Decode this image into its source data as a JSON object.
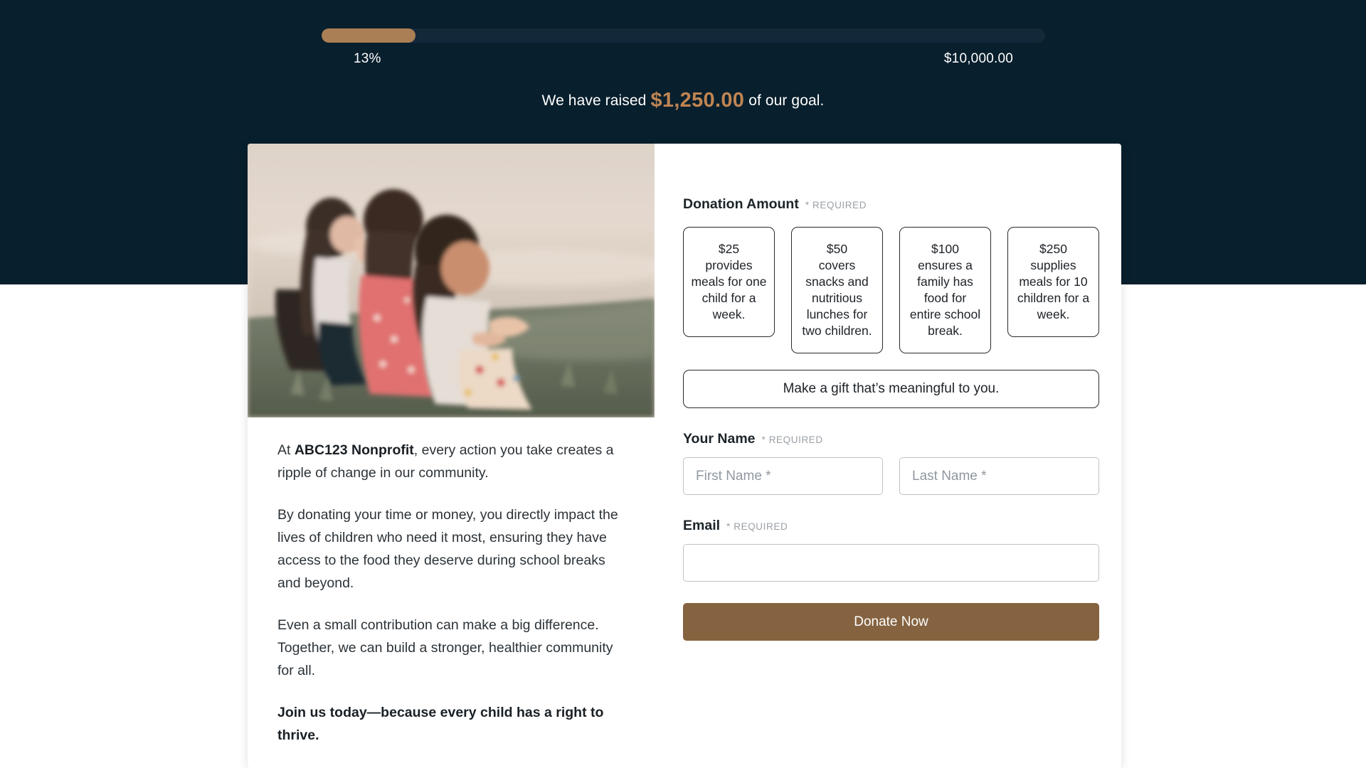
{
  "theme": {
    "band_background": "#081f2d",
    "progress_fill": "#ab7f55",
    "progress_track": "#13293a",
    "accent_amount": "#c08552",
    "button_background": "#856340",
    "card_background": "#ffffff"
  },
  "progress": {
    "percent_label": "13%",
    "percent_value": 13,
    "goal_label": "$10,000.00",
    "raised_prefix": "We have raised",
    "raised_amount": "$1,250.00",
    "raised_suffix": "of our goal."
  },
  "hero": {
    "alt": "Three children sitting together on grass looking out over a field"
  },
  "story": {
    "p1_lead": "At ",
    "p1_org": "ABC123 Nonprofit",
    "p1_rest": ", every action you take creates a ripple of change in our community.",
    "p2": "By donating your time or money, you directly impact the lives of children who need it most, ensuring they have access to the food they deserve during school breaks and beyond.",
    "p3": "Even a small contribution can make a big difference. Together, we can build a stronger, healthier community for all.",
    "p4": "Join us today—because every child has a right to thrive."
  },
  "form": {
    "donation_amount": {
      "label": "Donation Amount",
      "required_tag": "* REQUIRED",
      "options": [
        {
          "amount": "$25",
          "description": "provides meals for one child for a week."
        },
        {
          "amount": "$50",
          "description": "covers snacks and nutritious lunches for two children."
        },
        {
          "amount": "$100",
          "description": "ensures a family has food for entire school break."
        },
        {
          "amount": "$250",
          "description": "supplies meals for 10 children for a week."
        }
      ],
      "custom_label": "Make a gift that’s meaningful to you."
    },
    "your_name": {
      "label": "Your Name",
      "required_tag": "* REQUIRED",
      "first_name_placeholder": "First Name *",
      "first_name_value": "",
      "last_name_placeholder": "Last Name *",
      "last_name_value": ""
    },
    "email": {
      "label": "Email",
      "required_tag": "* REQUIRED",
      "placeholder": "",
      "value": ""
    },
    "submit_label": "Donate Now"
  }
}
